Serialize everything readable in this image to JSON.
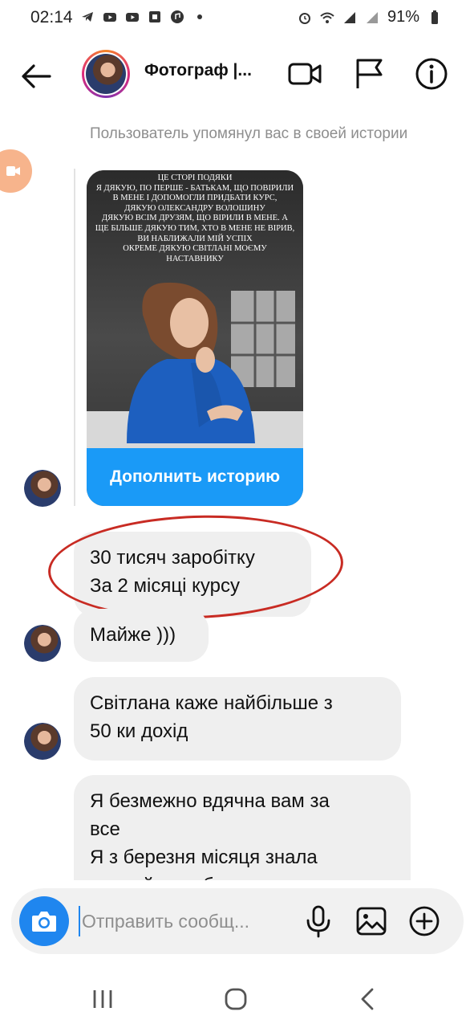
{
  "status_bar": {
    "time": "02:14",
    "battery": "91%",
    "icons": [
      "telegram-icon",
      "youtube-icon",
      "youtube-icon",
      "app-icon",
      "music-icon",
      "dot-icon",
      "alarm-icon",
      "wifi-icon",
      "signal-icon",
      "signal-icon",
      "battery-icon"
    ]
  },
  "header": {
    "title": "Фотограф |...",
    "icons": [
      "back-arrow-icon",
      "video-call-icon",
      "flag-icon",
      "info-icon"
    ]
  },
  "chat": {
    "mention_text": "Пользователь упомянул вас в своей истории",
    "story": {
      "text": "ЦЕ СТОРІ ПОДЯКИ\nЯ ДЯКУЮ, ПО ПЕРШЕ - БАТЬКАМ, ЩО ПОВІРИЛИ В МЕНЕ І ДОПОМОГЛИ ПРИДБАТИ КУРС,\nДЯКУЮ ОЛЕКСАНДРУ ВОЛОШИНУ\nДЯКУЮ ВСІМ ДРУЗЯМ, ЩО ВІРИЛИ В МЕНЕ. А ЩЕ БІЛЬШЕ ДЯКУЮ ТИМ, ХТО В МЕНЕ НЕ ВІРИВ, ВИ НАБЛИЖАЛИ МІЙ УСПІХ\nОКРЕМЕ ДЯКУЮ СВІТЛАНІ МОЄМУ НАСТАВНИКУ",
      "button_label": "Дополнить историю"
    },
    "messages": [
      {
        "text": "30 тисяч заробітку\nЗа 2 місяці курсу"
      },
      {
        "text": "Майже )))"
      },
      {
        "text": "Світлана каже найбільше з\n50 ки дохід"
      },
      {
        "text": "Я безмежно вдячна вам за\nвсе\nЯ з березня місяця знала\nщо цей курс буде тим"
      }
    ]
  },
  "composer": {
    "placeholder": "Отправить сообщ...",
    "icons": [
      "camera-icon",
      "microphone-icon",
      "gallery-icon",
      "plus-circle-icon"
    ]
  },
  "nav": {
    "icons": [
      "recents-icon",
      "home-icon",
      "back-icon"
    ]
  },
  "colors": {
    "accent_blue": "#1a9af7",
    "bubble_gray": "#efefef",
    "annotation_red": "#c82b23"
  }
}
